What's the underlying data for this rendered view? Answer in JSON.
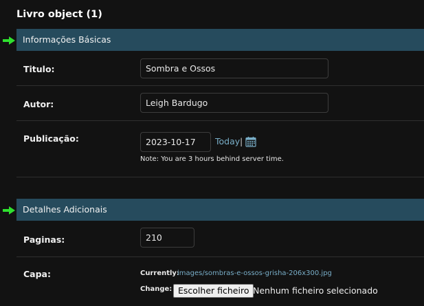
{
  "page_title": "Livro object (1)",
  "sections": [
    {
      "title": "Informações Básicas"
    },
    {
      "title": "Detalhes Adicionais"
    }
  ],
  "fields": {
    "titulo": {
      "label": "Titulo:",
      "value": "Sombra e Ossos"
    },
    "autor": {
      "label": "Autor:",
      "value": "Leigh Bardugo"
    },
    "publicacao": {
      "label": "Publicação:",
      "value": "2023-10-17",
      "today_label": "Today",
      "separator": "|",
      "calendar_icon": "calendar-icon",
      "note": "Note: You are 3 hours behind server time."
    },
    "paginas": {
      "label": "Paginas:",
      "value": "210"
    },
    "capa": {
      "label": "Capa:",
      "currently_label": "Currently:",
      "currently_value": "images/sombras-e-ossos-grisha-206x300.jpg",
      "change_label": "Change:",
      "button_label": "Escolher ficheiro",
      "status": "Nenhum ficheiro selecionado"
    }
  },
  "colors": {
    "background": "#121212",
    "section_header": "#264b5d",
    "link": "#79aec8",
    "arrow": "#2fe02f"
  },
  "icons": {
    "section_marker": "green-arrow-icon"
  }
}
